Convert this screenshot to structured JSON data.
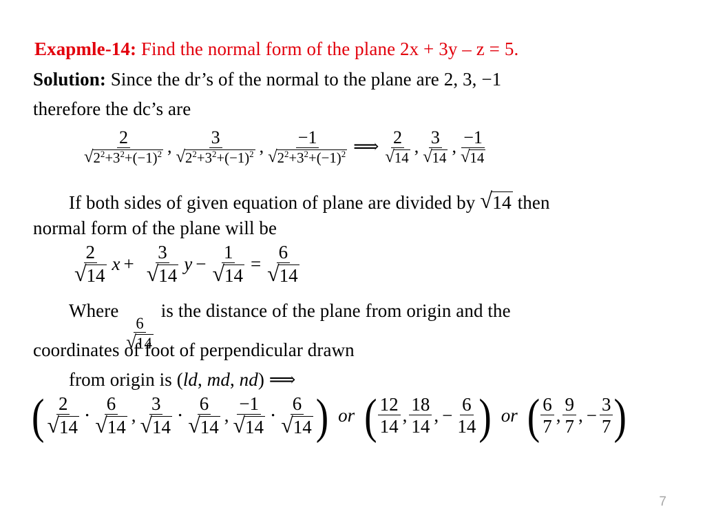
{
  "slide": {
    "page_number": "7",
    "accent_color": "#e2000c",
    "text_color": "#000000",
    "background": "#ffffff"
  },
  "heading": {
    "label": "Exapmle-14:",
    "text": " Find the normal form of the plane 2x + 3y – z = 5."
  },
  "solution": {
    "label": "Solution:",
    "text": " Since the dr’s of the normal to the plane are 2, 3, −1"
  },
  "line_therefore": "therefore the dc’s are",
  "dc_line": {
    "numerators": [
      "2",
      "3",
      "−1"
    ],
    "denominator": {
      "radicand_parts": [
        "2",
        "2",
        "+3",
        "2",
        "+(−1)",
        "2"
      ],
      "text": "2²+3²+(−1)²"
    },
    "separator": ",",
    "arrow": "⟹",
    "result_numerators": [
      "2",
      "3",
      "−1"
    ],
    "result_denominator": "14",
    "base_2": "2",
    "exp_2": "2",
    "base_3": "3",
    "exp_3": "2",
    "base_neg1": "(−1)",
    "exp_neg1": "2",
    "plus": "+"
  },
  "line_if_both": {
    "before": "If both sides of given equation of plane are divided by ",
    "radicand": "14",
    "after": " then"
  },
  "line_normal_form_will_be": "normal form of the plane will be",
  "normal_form": {
    "num_x": "2",
    "den_x": "14",
    "var_x": "x",
    "op1": "+",
    "num_y": "3",
    "den_y": "14",
    "var_y": "y",
    "op2": "−",
    "num_c": "1",
    "den_c": "14",
    "equals": "=",
    "num_r": "6",
    "den_r": "14"
  },
  "line_where": {
    "before": "Where ",
    "num": "6",
    "den": "14",
    "after": " is the distance of the plane from origin and the"
  },
  "line_coordinates": "coordinates of foot of perpendicular drawn",
  "line_from_origin": {
    "before": "from origin is (",
    "ld": "ld",
    "md": "md",
    "nd": "nd",
    "after": ") ",
    "arrow": "⟹"
  },
  "final_line": {
    "group1": {
      "terms": [
        {
          "num_a": "2",
          "den_a": "14",
          "num_b": "6",
          "den_b": "14"
        },
        {
          "num_a": "3",
          "den_a": "14",
          "num_b": "6",
          "den_b": "14"
        },
        {
          "num_a": "−1",
          "den_a": "14",
          "num_b": "6",
          "den_b": "14"
        }
      ],
      "dot": "⋅",
      "comma": ","
    },
    "or1": "or",
    "group2": {
      "values": [
        {
          "num": "12",
          "den": "14",
          "sign": ""
        },
        {
          "num": "18",
          "den": "14",
          "sign": ""
        },
        {
          "num": "6",
          "den": "14",
          "sign": "−"
        }
      ],
      "comma": ","
    },
    "or2": "or",
    "group3": {
      "values": [
        {
          "num": "6",
          "den": "7",
          "sign": ""
        },
        {
          "num": "9",
          "den": "7",
          "sign": ""
        },
        {
          "num": "3",
          "den": "7",
          "sign": "−"
        }
      ],
      "comma": ","
    },
    "lparen": "(",
    "rparen": ")"
  }
}
